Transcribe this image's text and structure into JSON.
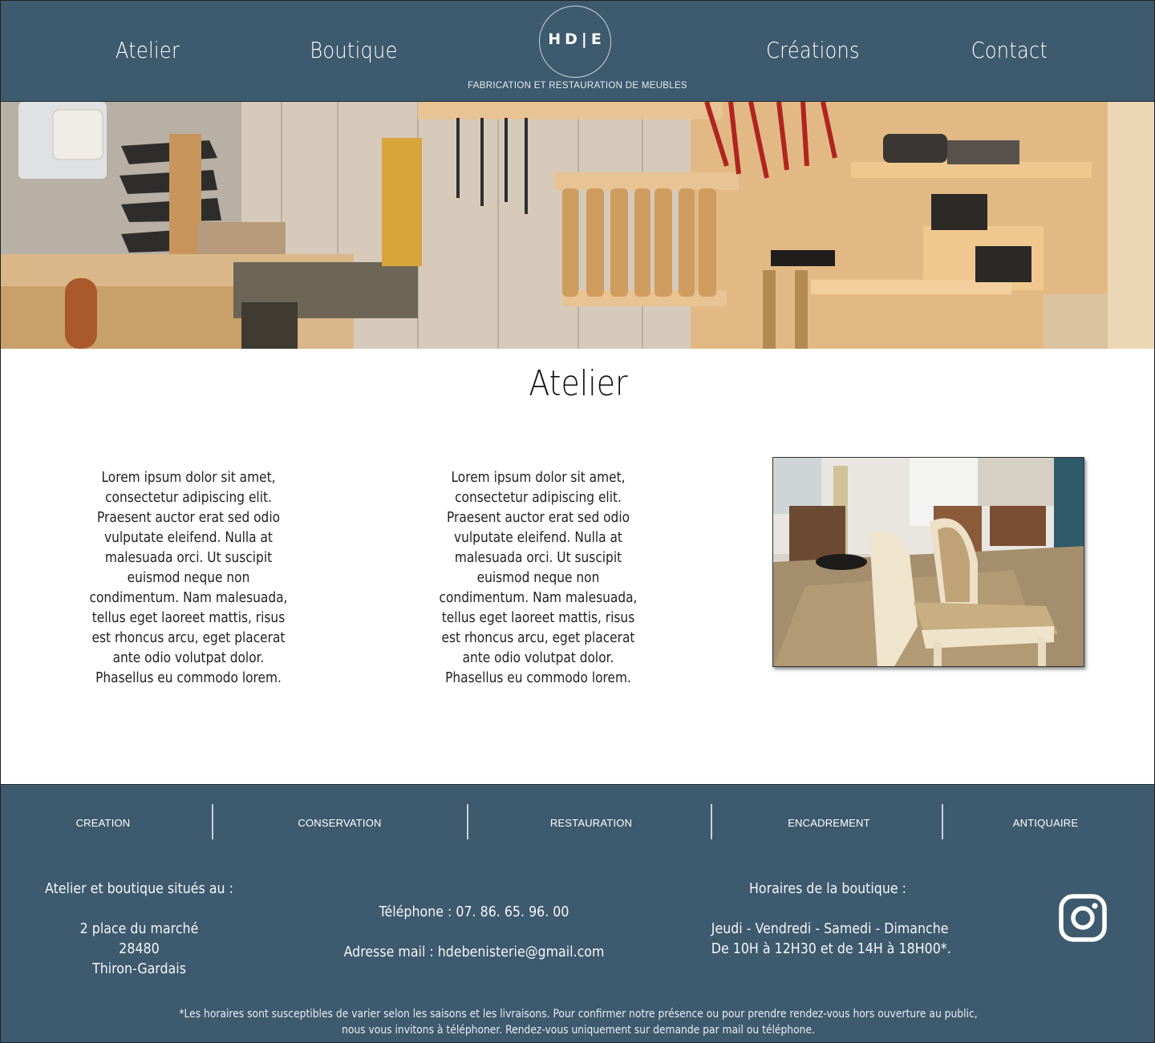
{
  "header": {
    "nav": [
      "Atelier",
      "Boutique",
      "Créations",
      "Contact"
    ],
    "logo_text": "HD|E",
    "tagline": "FABRICATION ET RESTAURATION DE MEUBLES"
  },
  "main": {
    "title": "Atelier",
    "text_col_1": "Lorem ipsum dolor sit amet, consectetur adipiscing elit. Praesent auctor erat sed odio vulputate eleifend. Nulla at malesuada orci. Ut suscipit euismod neque non condimentum. Nam malesuada, tellus eget laoreet mattis, risus est rhoncus arcu, eget placerat ante odio volutpat dolor. Phasellus eu commodo lorem.",
    "text_col_2": "Lorem ipsum dolor sit amet, consectetur adipiscing elit. Praesent auctor erat sed odio vulputate eleifend. Nulla at malesuada orci. Ut suscipit euismod neque non condimentum. Nam malesuada, tellus eget laoreet mattis, risus est rhoncus arcu, eget placerat ante odio volutpat dolor. Phasellus eu commodo lorem."
  },
  "footer": {
    "services": [
      "CREATION",
      "CONSERVATION",
      "RESTAURATION",
      "ENCADREMENT",
      "ANTIQUAIRE"
    ],
    "address": {
      "heading": "Atelier et boutique situés au  :",
      "street": "2 place du marché",
      "postcode": "28480",
      "city": "Thiron-Gardais"
    },
    "contact": {
      "phone": "Téléphone : 07. 86. 65. 96. 00",
      "email": "Adresse mail :  hdebenisterie@gmail.com"
    },
    "hours": {
      "heading": "Horaires de la boutique :",
      "days": "Jeudi - Vendredi - Samedi - Dimanche",
      "times": "De 10H à 12H30 et de 14H à 18H00*."
    },
    "footnote_line1": "*Les horaires sont susceptibles de varier selon les saisons et les livraisons. Pour confirmer notre présence ou pour prendre rendez-vous hors ouverture au public,",
    "footnote_line2": "nous vous invitons à téléphoner. Rendez-vous uniquement sur demande par mail ou téléphone.",
    "instagram_icon": "instagram-icon"
  },
  "colors": {
    "header_footer_bg": "#3d5a6e",
    "text_light": "#ffffff",
    "body_text": "#222222"
  }
}
